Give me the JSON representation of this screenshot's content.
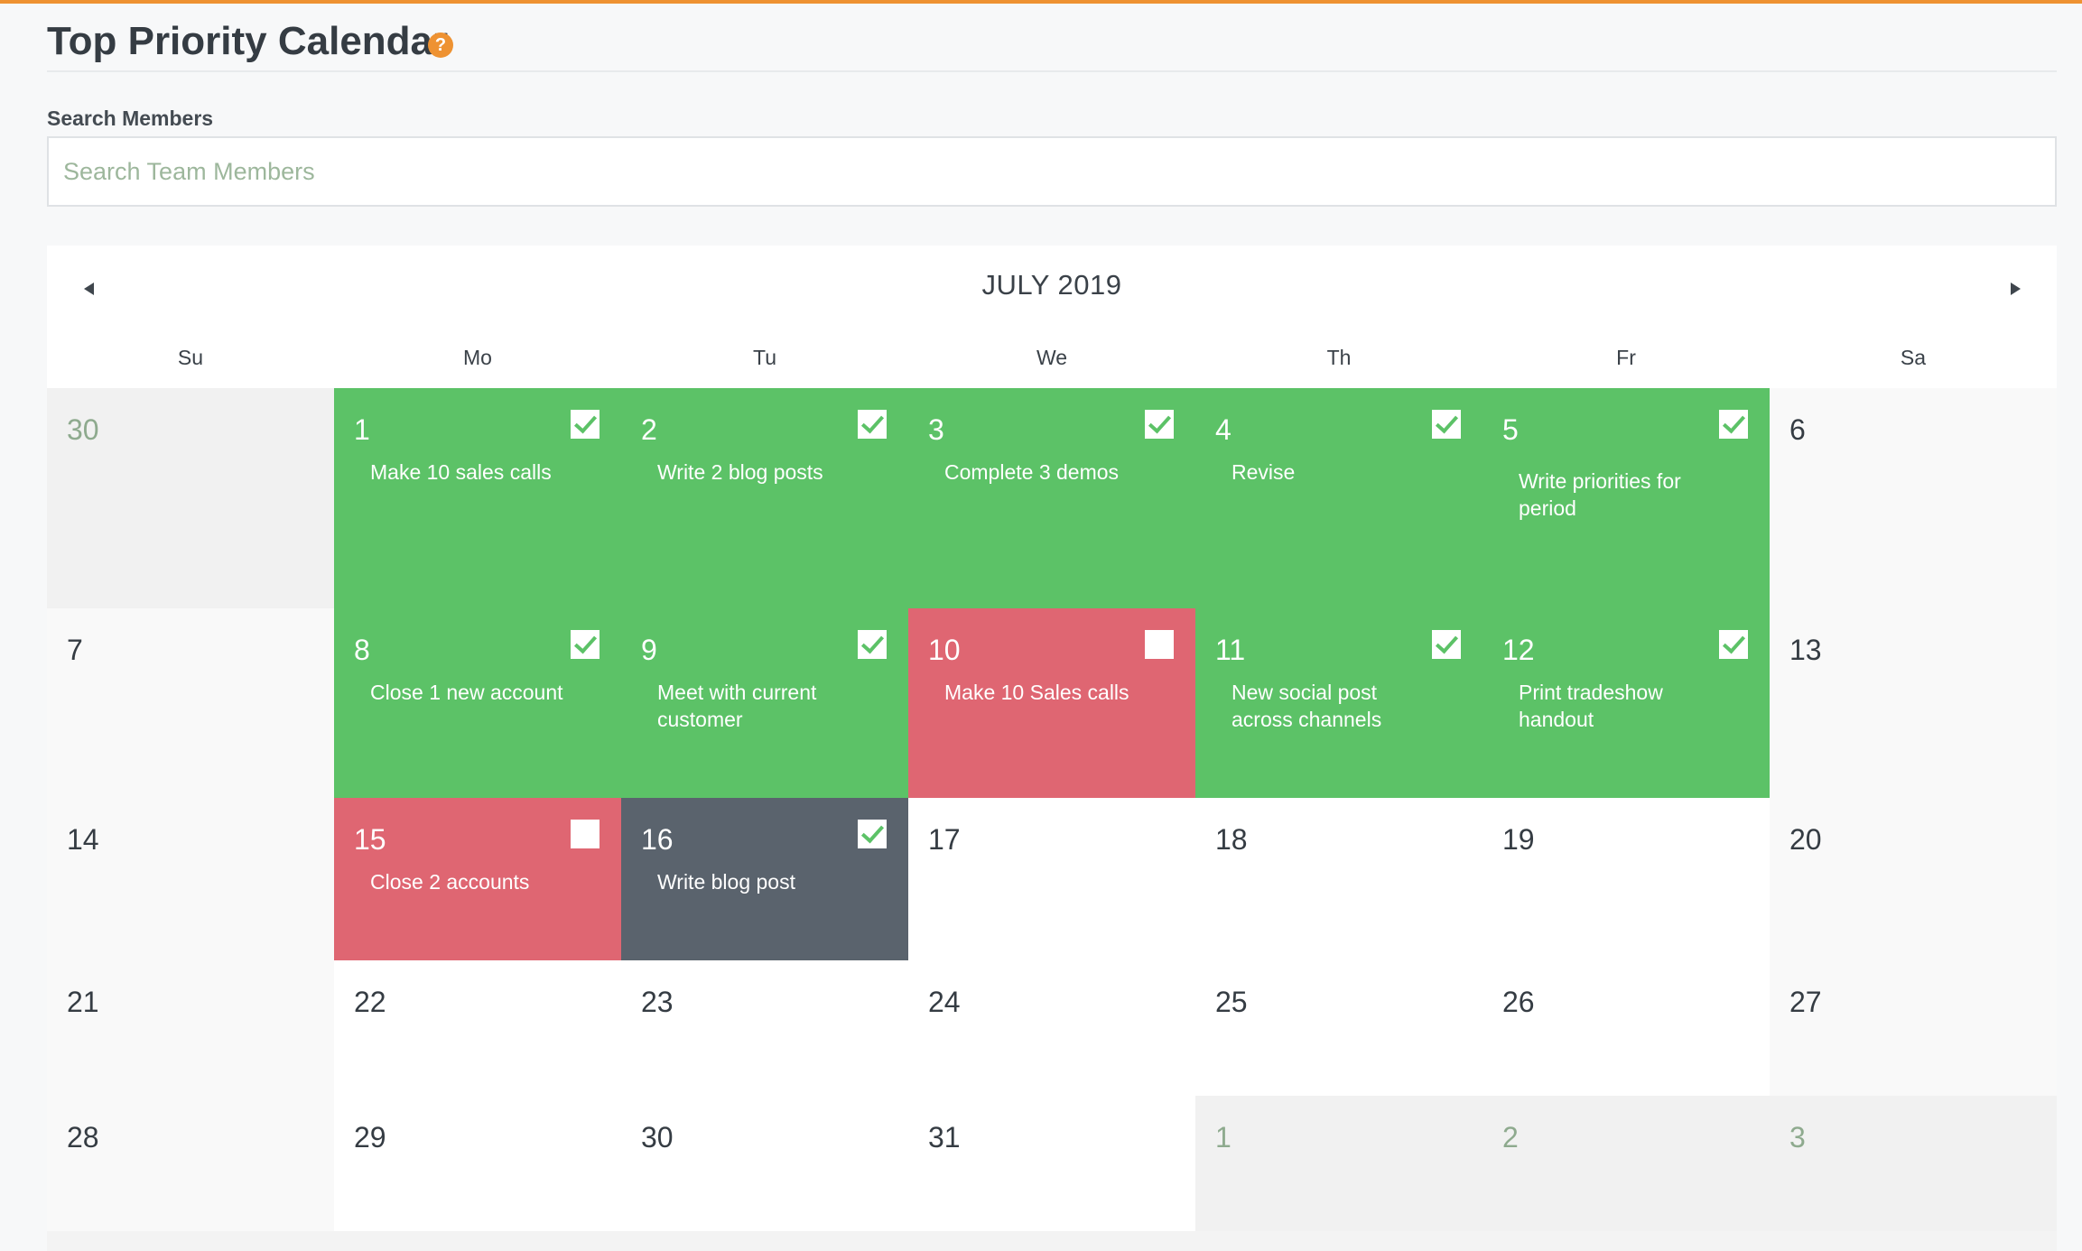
{
  "page": {
    "title": "Top Priority Calendar",
    "help_icon": "?",
    "accent_color": "#ee9232"
  },
  "search": {
    "label": "Search Members",
    "placeholder": "Search Team Members",
    "value": ""
  },
  "calendar": {
    "month_label": "JULY 2019",
    "weekdays": [
      "Su",
      "Mo",
      "Tu",
      "We",
      "Th",
      "Fr",
      "Sa"
    ],
    "status_colors": {
      "completed": "#5cc267",
      "missed": "#df6672",
      "neutral": "#5a636d"
    },
    "weeks": [
      [
        {
          "day": "30",
          "outside_month": true
        },
        {
          "day": "1",
          "status": "completed",
          "task": "Make 10 sales calls",
          "checked": true
        },
        {
          "day": "2",
          "status": "completed",
          "task": "Write 2 blog posts",
          "checked": true
        },
        {
          "day": "3",
          "status": "completed",
          "task": "Complete 3 demos",
          "checked": true
        },
        {
          "day": "4",
          "status": "completed",
          "task": "Revise",
          "checked": true
        },
        {
          "day": "5",
          "status": "completed",
          "task": "Write priorities for period",
          "checked": true
        },
        {
          "day": "6"
        }
      ],
      [
        {
          "day": "7"
        },
        {
          "day": "8",
          "status": "completed",
          "task": "Close 1 new account",
          "checked": true
        },
        {
          "day": "9",
          "status": "completed",
          "task": "Meet with current customer",
          "checked": true
        },
        {
          "day": "10",
          "status": "missed",
          "task": "Make 10 Sales calls",
          "checked": false
        },
        {
          "day": "11",
          "status": "completed",
          "task": "New social post across channels",
          "checked": true
        },
        {
          "day": "12",
          "status": "completed",
          "task": "Print tradeshow handout",
          "checked": true
        },
        {
          "day": "13"
        }
      ],
      [
        {
          "day": "14"
        },
        {
          "day": "15",
          "status": "missed",
          "task": "Close 2 accounts",
          "checked": false
        },
        {
          "day": "16",
          "status": "neutral",
          "task": "Write blog post",
          "checked": true
        },
        {
          "day": "17"
        },
        {
          "day": "18"
        },
        {
          "day": "19"
        },
        {
          "day": "20"
        }
      ],
      [
        {
          "day": "21"
        },
        {
          "day": "22"
        },
        {
          "day": "23"
        },
        {
          "day": "24"
        },
        {
          "day": "25"
        },
        {
          "day": "26"
        },
        {
          "day": "27"
        }
      ],
      [
        {
          "day": "28"
        },
        {
          "day": "29"
        },
        {
          "day": "30"
        },
        {
          "day": "31"
        },
        {
          "day": "1",
          "outside_month": true
        },
        {
          "day": "2",
          "outside_month": true
        },
        {
          "day": "3",
          "outside_month": true
        }
      ]
    ]
  }
}
